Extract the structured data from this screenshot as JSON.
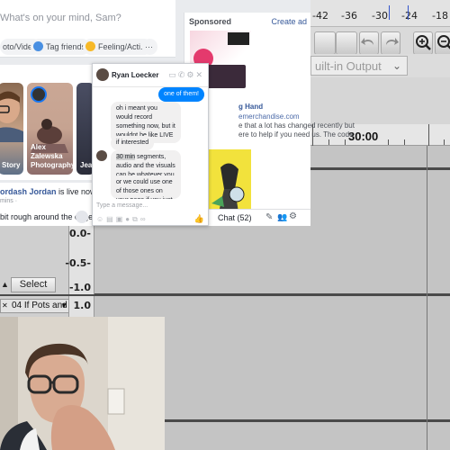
{
  "audacity": {
    "meter_ticks": [
      "-42",
      "-36",
      "-30",
      "-24",
      "-18"
    ],
    "device_select": "uilt-in Output",
    "timeline_label": "30:00",
    "scale_labels": [
      "0.0-",
      "-0.5-",
      "-1.0"
    ],
    "scale_top2": "1.0",
    "select_button": "Select",
    "track_name": "04 If Pots and"
  },
  "facebook": {
    "composer_prompt": "What's on your mind, Sam?",
    "chips": [
      "oto/Video",
      "Tag friends",
      "Feeling/Acti..."
    ],
    "chip_more": "···",
    "stories": [
      {
        "caption": "Story"
      },
      {
        "caption": "Alex Zalewska Photography"
      },
      {
        "caption": "Jea"
      }
    ],
    "live_post": {
      "line1_name": "ordash Jordan",
      "line1_rest": " is live now.",
      "meta": "mins ·",
      "text": "bit rough around the edges"
    },
    "sponsored": {
      "heading": "Sponsored",
      "create_ad": "Create ad",
      "ad_lines": [
        "g Hand",
        "emerchandise.com",
        "e that a lot has changed recently but",
        "ere to help if you need us. The code"
      ]
    },
    "chat_bar": {
      "label": "Chat (52)"
    }
  },
  "messenger": {
    "contact_name": "Ryan Loecker",
    "messages": [
      {
        "from": "me",
        "text": "one of them!"
      },
      {
        "from": "them",
        "text": "oh i meant you would record something now, but it wouldnt be like LIVE"
      },
      {
        "from": "them",
        "text": "if interested"
      },
      {
        "from": "them",
        "text_hl": "30 min",
        "text": " segments, audio and the visuals can be whatever you want"
      },
      {
        "from": "them",
        "text": "or we could use one of those ones on your page if you just wanted to"
      }
    ],
    "input_placeholder": "Type a message..."
  }
}
